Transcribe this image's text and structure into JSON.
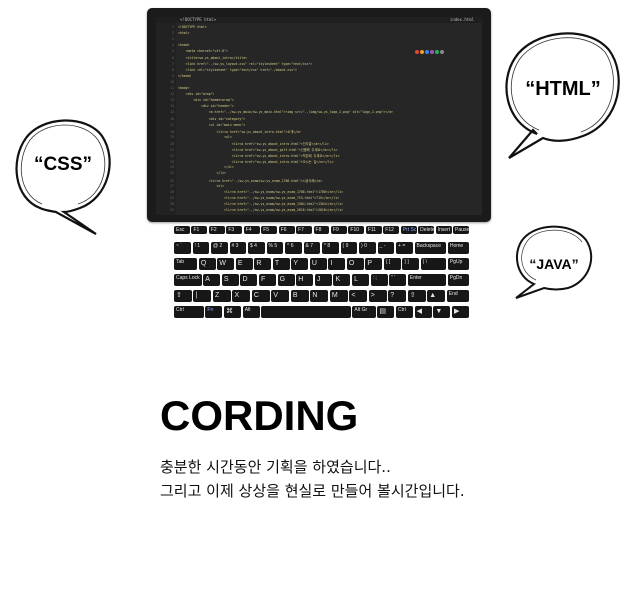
{
  "bubbles": {
    "html": "“HTML”",
    "css": "“CSS”",
    "java": "“JAVA”"
  },
  "title": "CORDING",
  "subtitle_line1": "충분한 시간동안 기획을 하였습니다..",
  "subtitle_line2": "그리고 이제 상상을 현실로 만들어 볼시간입니다.",
  "editor": {
    "tab_left": "<!DOCTYPE html>",
    "tab_right": "index.html",
    "lines": [
      {
        "n": "1",
        "text": "<!DOCTYPE html>"
      },
      {
        "n": "2",
        "text": "<html>"
      },
      {
        "n": "3",
        "text": ""
      },
      {
        "n": "4",
        "text": "<head>"
      },
      {
        "n": "5",
        "text": "    <meta charset=\"utf-8\">"
      },
      {
        "n": "6",
        "text": "    <title>sw-ys_about_intro</title>"
      },
      {
        "n": "7",
        "text": "    <link href=\"../sw-ys_layout.css\" rel=\"stylesheet\" type=\"text/css\">"
      },
      {
        "n": "8",
        "text": "    <link rel=\"stylesheet\" type=\"text/css\" href=\"./about.css\">"
      },
      {
        "n": "9",
        "text": "</head>"
      },
      {
        "n": "10",
        "text": ""
      },
      {
        "n": "11",
        "text": "<body>"
      },
      {
        "n": "12",
        "text": "    <div id=\"wrap\">"
      },
      {
        "n": "13",
        "text": "        <div id=\"headerwrap\">"
      },
      {
        "n": "14",
        "text": "            <div id=\"header\">"
      },
      {
        "n": "15",
        "text": "                <a href=\"../sw-ys_main/sw-ys_main.html\"><img src=\"../img/sw-ys_logo_2.png\" alt=\"logo_2.png\"></a>"
      },
      {
        "n": "16",
        "text": "                <div id=\"category\">"
      },
      {
        "n": "17",
        "text": "                <ul id=\"main menu\">"
      },
      {
        "n": "18",
        "text": "                    <li><a href=\"sw-ys_about_intro.html\">소개</a>"
      },
      {
        "n": "19",
        "text": "                        <ul>"
      },
      {
        "n": "20",
        "text": "                            <li><a href=\"sw-ys_about_intro.html\">인사말</a></li>"
      },
      {
        "n": "21",
        "text": "                            <li><a href=\"sw-ys_about_gift.html\">선물해 주세요</a></li>"
      },
      {
        "n": "22",
        "text": "                            <li><a href=\"sw-ys_about_intro.html\">작은배 주세요</a></li>"
      },
      {
        "n": "23",
        "text": "                            <li><a href=\"sw-ys_about_intro.html\">오시는 길</a></li>"
      },
      {
        "n": "24",
        "text": "                        </ul>"
      },
      {
        "n": "25",
        "text": "                    </li>"
      },
      {
        "n": "26",
        "text": "                <li><a href=\"../sw-ys_exam/sw-ys_exam_1786.html\">시공사례</a>"
      },
      {
        "n": "27",
        "text": "                    <ul>"
      },
      {
        "n": "28",
        "text": "                        <li><a href=\"../sw-ys_exam/sw-ys_exam_1786.html\">1786</a></li>"
      },
      {
        "n": "29",
        "text": "                        <li><a href=\"../sw-ys_exam/sw-ys_exam_715.html\">715</a></li>"
      },
      {
        "n": "30",
        "text": "                        <li><a href=\"../sw-ys_exam/sw-ys_exam_1364.html\">1364</a></li>"
      },
      {
        "n": "31",
        "text": "                        <li><a href=\"../sw-ys_exam/sw-ys_exam_2016.html\">2016</a></li>"
      }
    ]
  },
  "keyboard": {
    "rows": [
      [
        "Esc",
        "F1",
        "F2",
        "F3",
        "F4",
        "F5",
        "F6",
        "F7",
        "F8",
        "F9",
        "F10",
        "F11",
        "F12",
        "Prt Sc",
        "Delete",
        "Insert",
        "Pause Break"
      ],
      [
        "~ `",
        "! 1",
        "@ 2",
        "# 3",
        "$ 4",
        "% 5",
        "^ 6",
        "& 7",
        "* 8",
        "( 9",
        ") 0",
        "_ -",
        "+ =",
        "Backspace",
        "Home"
      ],
      [
        "Tab",
        "Q",
        "W",
        "E",
        "R",
        "T",
        "Y",
        "U",
        "I",
        "O",
        "P",
        "{ [",
        "} ]",
        "| \\",
        "PgUp"
      ],
      [
        "Caps Lock",
        "A",
        "S",
        "D",
        "F",
        "G",
        "H",
        "J",
        "K",
        "L",
        ": ;",
        "\" '",
        "Enter",
        "PgDn"
      ],
      [
        "⇧",
        "|",
        "Z",
        "X",
        "C",
        "V",
        "B",
        "N",
        "M",
        "<",
        ">",
        "?",
        "⇧",
        "▲",
        "End"
      ],
      [
        "Ctrl",
        "Fn",
        "⌘",
        "Alt",
        "",
        "Alt Gr",
        "▤",
        "Ctrl",
        "◀",
        "▼",
        "▶"
      ]
    ]
  }
}
